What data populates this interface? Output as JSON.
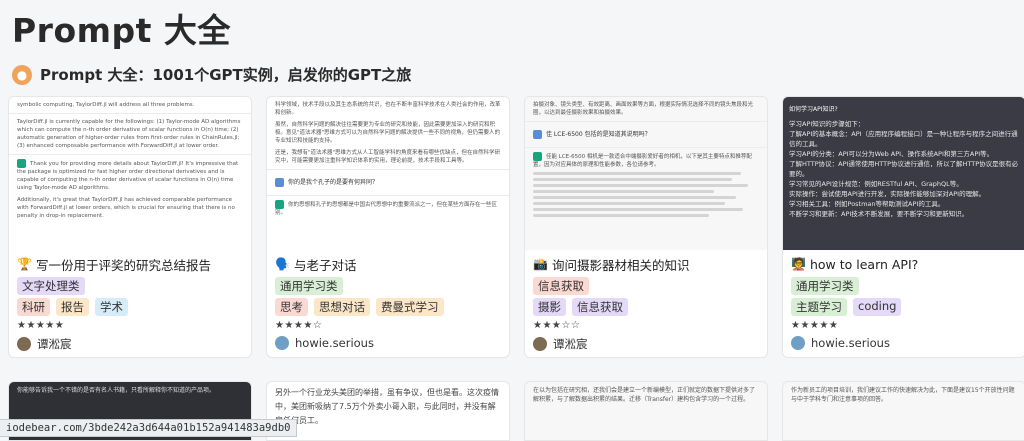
{
  "page": {
    "title": "Prompt 大全",
    "subtitle": "Prompt 大全：1001个GPT实例，启发你的GPT之旅",
    "subtitle_icon": "owl-icon"
  },
  "cards": [
    {
      "icon": "🏆",
      "title": "写一份用于评奖的研究总结报告",
      "thumb_style": "light",
      "thumb_lines": [
        "symbolic computing, TaylorDiff.jl will address all three problems.",
        "TaylorDiff.jl is currently capable for the followings: (1) Taylor-mode AD algorithms which can compute the n-th order derivative of scalar functions in O(n) time; (2) automatic generation of higher-order rules from first-order rules in ChainRules.jl; (3) enhanced composable performance with ForwardDiff.jl at lower order.",
        "Thank you for providing more details about TaylorDiff.jl! It's impressive that the package is optimized for fast higher order directional derivatives and is capable of computing the n-th order derivative of scalar functions in O(n) time using Taylor-mode AD algorithms.",
        "Additionally, it's great that TaylorDiff.jl has achieved comparable performance with ForwardDiff.jl at lower orders, which is crucial for ensuring that there is no penalty in drop-in replacement."
      ],
      "tags": [
        {
          "label": "文字处理类",
          "color": "#e4d9f7"
        },
        {
          "label": "科研",
          "color": "#fbd9d3"
        },
        {
          "label": "报告",
          "color": "#fbe7c8"
        },
        {
          "label": "学术",
          "color": "#d6ecf7"
        }
      ],
      "rating": 5,
      "stars": "★★★★★",
      "author": "谭淞宸",
      "avatar_style": "brown"
    },
    {
      "icon": "🗣️",
      "title": "与老子对话",
      "thumb_style": "light",
      "thumb_lines": [
        "科学领域，技术手段以及其生态系统的共识，也在不断丰富科学技术在人类社会的作用，改革和创新。",
        "虽然，自然科学问题的解决往往需要更为专业的研究和技能，因此需要更加深入的研究和积极。意见\"道法术器\"思维方式可以为自然科学问题的解决提供一些不同的视角，但仍需要人的专业知识和技能的支持。",
        "还是，我想有\"道法术器\"思维方式从人工智能学科的角度来看有哪些优缺点，但在自然科学研究中，可能需要更加注重科学知识体系的实用，理论前提，技术手段和工具等。"
      ],
      "question": "你的是我个孔子的是要有何异同？",
      "answer": "你的思想和孔子的思想都是中国古代思想中的重要流派之一，但在某些方面存在一些区别。",
      "tags": [
        {
          "label": "通用学习类",
          "color": "#d8efd6"
        },
        {
          "label": "思考",
          "color": "#fbd9d3"
        },
        {
          "label": "思想对话",
          "color": "#fbe7c8"
        },
        {
          "label": "费曼式学习",
          "color": "#fbe7c8"
        }
      ],
      "rating": 4,
      "stars": "★★★★☆",
      "author": "howie.serious",
      "avatar_style": "blue"
    },
    {
      "icon": "📸",
      "title": "询问摄影器材相关的知识",
      "thumb_style": "gray",
      "thumb_lines": [
        "拍摄对象、镜头类型、有效距离、画面效果等方面，根据实际情况选择不同的镜头焦段和光圈，以达到最佳摄影效果和拍摄效果。"
      ],
      "question": "佳 LCE-6500 包括的是知道其说明吗？",
      "answer": "佳能 LCE-6500 相机是一款适合中端摄影爱好者的相机，以下是其主要特点和推荐配置，因为对应具体的原理和性能参数，各位请参考。",
      "tags": [
        {
          "label": "信息获取",
          "color": "#fbd9d3"
        },
        {
          "label": "摄影",
          "color": "#e4d9f7"
        },
        {
          "label": "信息获取",
          "color": "#e4d9f7"
        }
      ],
      "rating": 3,
      "stars": "★★★☆☆",
      "author": "谭淞宸",
      "avatar_style": "brown"
    },
    {
      "icon": "🧑‍🏫",
      "title": "how to learn API?",
      "thumb_style": "dark",
      "thumb_lines": [
        "如何学习API知识?",
        "学习API知识的步骤如下：",
        "了解API的基本概念：API（应用程序编程接口）是一种让程序与程序之间进行通信的工具。",
        "学习API的分类：API可以分为Web API、操作系统API和第三方API等。",
        "了解HTTP协议：API通常使用HTTP协议进行通信，所以了解HTTP协议是很有必要的。",
        "学习常见的API设计规范：例如RESTful API、GraphQL等。",
        "实际操作：尝试使用API进行开发，实际操作能够加深对API的理解。",
        "学习相关工具：例如Postman等帮助测试API的工具。",
        "不断学习和更新：API技术不断发展，要不断学习和更新知识。"
      ],
      "tags": [
        {
          "label": "通用学习类",
          "color": "#d8efd6"
        },
        {
          "label": "主题学习",
          "color": "#d8efd6"
        },
        {
          "label": "coding",
          "color": "#e4d9f7"
        }
      ],
      "rating": 5,
      "stars": "★★★★★",
      "author": "howie.serious",
      "avatar_style": "blue"
    }
  ],
  "row2": [
    {
      "style": "dark",
      "text": "你能够告诉我一个不错的是否有名人书籍，只看所解释你不知道的产品项。"
    },
    {
      "style": "light",
      "text": "另外一个行业龙头美团的举措，虽有争议，但也是看。这次疫情中，美团新吸纳了7.5万个外卖小哥入职，与此同时，并没有解雇任何员工。"
    },
    {
      "style": "gray",
      "text": "在以为包括在研究相，还我们会是建立一个新编模型，正们就定的数据下提供对多了解积累，与了解数据出积累的结果。迁移（Transfer）建构包含学习的一个过程。"
    },
    {
      "style": "light",
      "text": "作为新员工的项目培训，我们建议工作的快速解决为此，下面是建议15个开放性问题与中于学科专门和注意事项的回答。"
    }
  ],
  "status_bar": "iodebear.com/3bde242a3d644a01b152a941483a9db0"
}
